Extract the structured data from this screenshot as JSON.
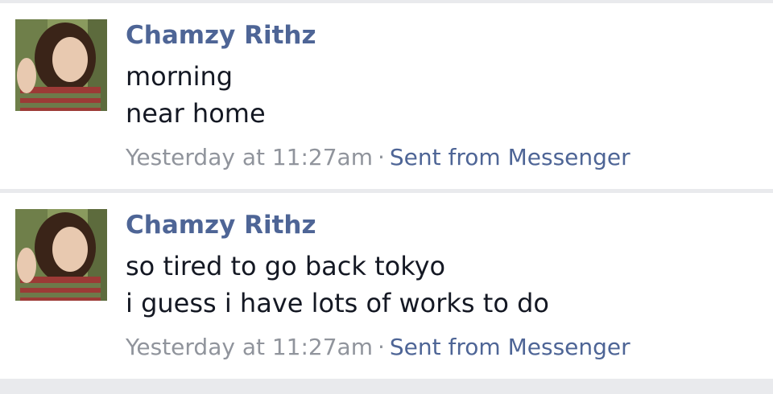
{
  "messages": [
    {
      "sender": "Chamzy Rithz",
      "lines": [
        "morning",
        "near home"
      ],
      "timestamp": "Yesterday at 11:27am",
      "separator": "·",
      "via": "Sent from Messenger"
    },
    {
      "sender": "Chamzy Rithz",
      "lines": [
        "so tired to go back tokyo",
        "i guess i have lots of works to do"
      ],
      "timestamp": "Yesterday at 11:27am",
      "separator": "·",
      "via": "Sent from Messenger"
    }
  ],
  "colors": {
    "background": "#e9eaed",
    "card": "#ffffff",
    "link": "#4e6596",
    "text": "#141823",
    "muted": "#90949c"
  }
}
